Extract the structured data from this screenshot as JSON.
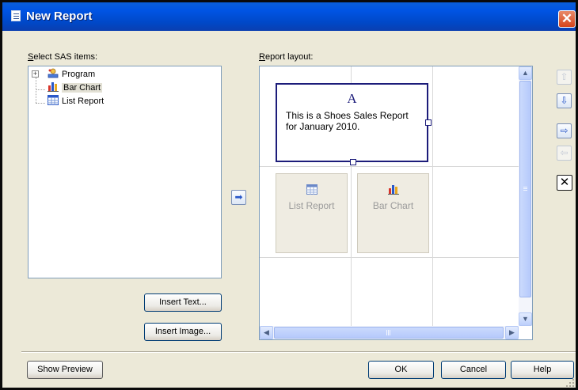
{
  "window": {
    "title": "New Report",
    "close_label": "✕"
  },
  "left_panel": {
    "label": "Select SAS items:",
    "tree": [
      {
        "label": "Program",
        "icon": "program-icon",
        "expanded": false
      },
      {
        "label": "Bar Chart",
        "icon": "bar-chart-icon",
        "selected": true
      },
      {
        "label": "List Report",
        "icon": "list-report-icon"
      }
    ],
    "insert_text_label": "Insert Text...",
    "insert_image_label": "Insert Image..."
  },
  "add_arrow": "➡",
  "right_panel": {
    "label": "Report layout:",
    "text_block": {
      "icon_letter": "A",
      "text": "This is a Shoes Sales Report for January 2010."
    },
    "tiles": [
      {
        "label": "List Report",
        "icon": "list-report-icon"
      },
      {
        "label": "Bar Chart",
        "icon": "bar-chart-icon"
      }
    ]
  },
  "side_controls": {
    "up_label": "⇧",
    "down_label": "⇩",
    "right_label": "⇨",
    "left_label": "⇦",
    "remove_label": "✕"
  },
  "footer": {
    "show_preview_label": "Show Preview",
    "ok_label": "OK",
    "cancel_label": "Cancel",
    "help_label": "Help"
  },
  "colors": {
    "title_bar": "#0054e3",
    "dialog_bg": "#ece9d8",
    "text_block_border": "#1c1c7a",
    "scrollbar": "#bccffb"
  }
}
